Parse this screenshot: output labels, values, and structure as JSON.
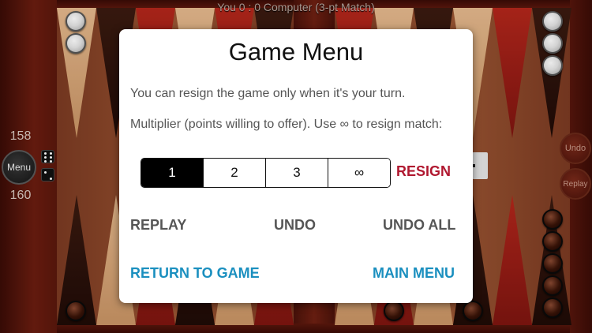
{
  "score_text": "You 0 : 0 Computer (3-pt Match)",
  "left_panel": {
    "top_pip": "158",
    "bottom_pip": "160",
    "menu_label": "Menu"
  },
  "right_panel": {
    "undo_label": "Undo",
    "replay_label": "Replay"
  },
  "dice": [
    6,
    2
  ],
  "dialog": {
    "title": "Game Menu",
    "resign_note": "You can resign the game only when it's your turn.",
    "multiplier_label": "Multiplier (points willing to offer). Use ∞ to resign match:",
    "multiplier_options": [
      "1",
      "2",
      "3",
      "∞"
    ],
    "selected_multiplier": "1",
    "resign_label": "RESIGN",
    "replay_label": "REPLAY",
    "undo_label": "UNDO",
    "undo_all_label": "UNDO ALL",
    "return_label": "RETURN TO GAME",
    "main_menu_label": "MAIN MENU"
  },
  "colors": {
    "resign": "#b01830",
    "link_blue": "#1a8fbf",
    "action_gray": "#555555",
    "selected_segment": "#000000"
  }
}
